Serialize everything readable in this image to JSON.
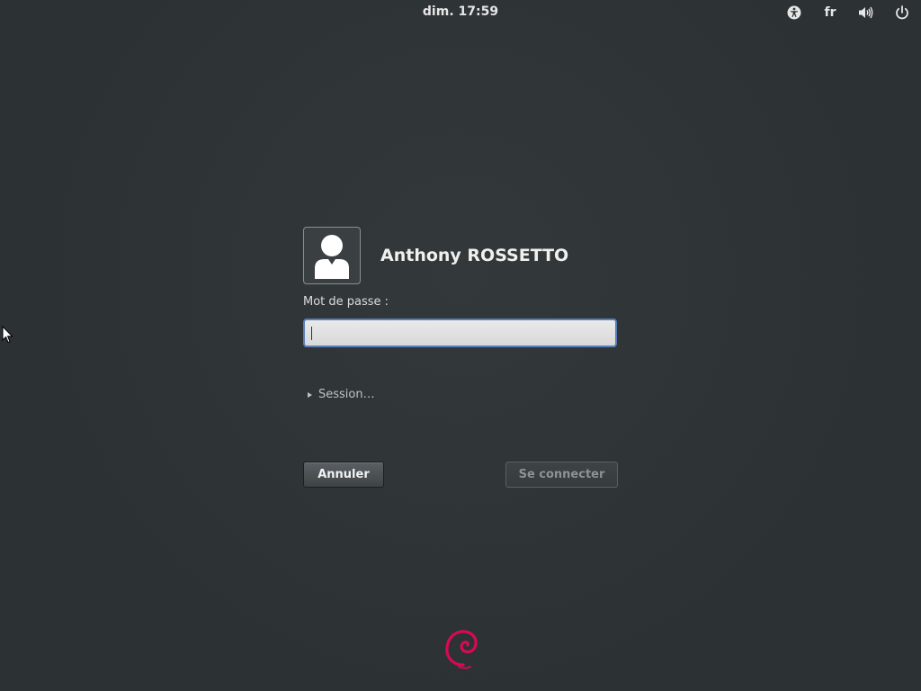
{
  "top_bar": {
    "clock": "dim. 17:59",
    "language": "fr",
    "icons": [
      "accessibility-icon",
      "volume-icon",
      "power-icon"
    ]
  },
  "login": {
    "user_name": "Anthony ROSSETTO",
    "password_label": "Mot de passe :",
    "password_value": "",
    "session_label": "Session…",
    "cancel_label": "Annuler",
    "login_label": "Se connecter"
  },
  "colors": {
    "background": "#2c3133",
    "focus_border": "#5a7fb8",
    "logo": "#d70a53"
  }
}
